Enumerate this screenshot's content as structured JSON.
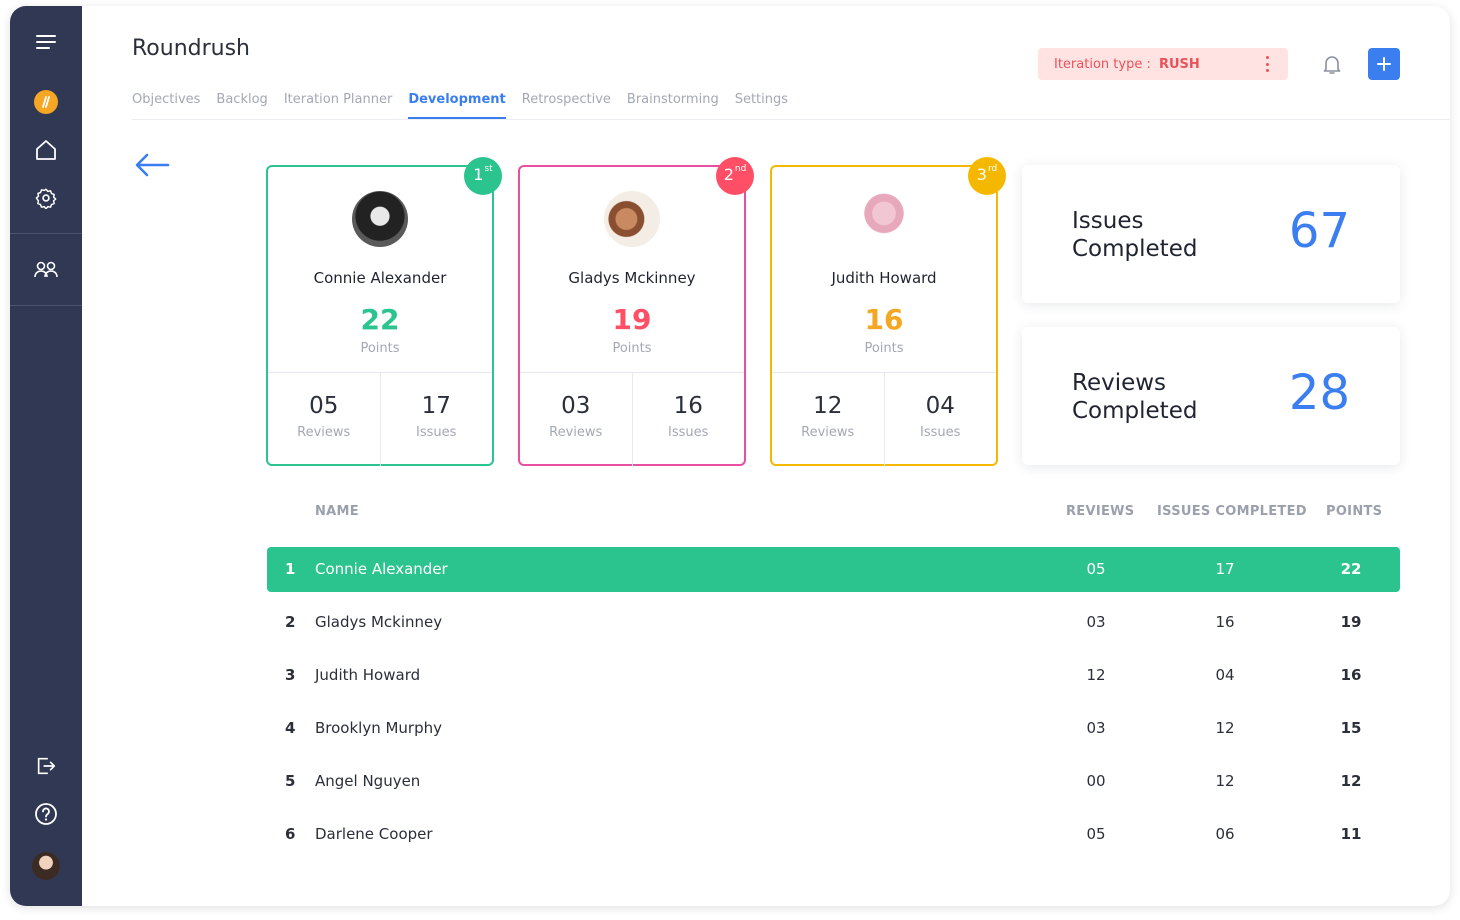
{
  "app": {
    "title": "Roundrush"
  },
  "tabs": [
    {
      "label": "Objectives",
      "active": false
    },
    {
      "label": "Backlog",
      "active": false
    },
    {
      "label": "Iteration Planner",
      "active": false
    },
    {
      "label": "Development",
      "active": true
    },
    {
      "label": "Retrospective",
      "active": false
    },
    {
      "label": "Brainstorming",
      "active": false
    },
    {
      "label": "Settings",
      "active": false
    }
  ],
  "iteration": {
    "label": "Iteration type : ",
    "value": "RUSH"
  },
  "colors": {
    "sidebar": "#303853",
    "accent": "#3b7ef0",
    "first": "#2bc48e",
    "second": "#ff4f66",
    "third": "#f5b800",
    "highlight_row": "#2bc48e"
  },
  "podium": [
    {
      "rank": "1",
      "suffix": "st",
      "name": "Connie Alexander",
      "points": "22",
      "points_label": "Points",
      "reviews": "05",
      "reviews_label": "Reviews",
      "issues": "17",
      "issues_label": "Issues",
      "border_color": "#2bc48e",
      "badge_color": "#2bc48e",
      "points_color": "#2bc48e"
    },
    {
      "rank": "2",
      "suffix": "nd",
      "name": "Gladys Mckinney",
      "points": "19",
      "points_label": "Points",
      "reviews": "03",
      "reviews_label": "Reviews",
      "issues": "16",
      "issues_label": "Issues",
      "border_color": "#e94fa0",
      "badge_color": "#ff4f66",
      "points_color": "#ff4f66"
    },
    {
      "rank": "3",
      "suffix": "rd",
      "name": "Judith Howard",
      "points": "16",
      "points_label": "Points",
      "reviews": "12",
      "reviews_label": "Reviews",
      "issues": "04",
      "issues_label": "Issues",
      "border_color": "#f5b800",
      "badge_color": "#f5b800",
      "points_color": "#f5a623"
    }
  ],
  "summary": [
    {
      "label": "Issues Completed",
      "value": "67"
    },
    {
      "label": "Reviews Completed",
      "value": "28"
    }
  ],
  "table": {
    "headers": {
      "name": "NAME",
      "reviews": "REVIEWS",
      "issues": "ISSUES COMPLETED",
      "points": "POINTS"
    },
    "rows": [
      {
        "rank": "1",
        "name": "Connie Alexander",
        "reviews": "05",
        "issues": "17",
        "points": "22",
        "highlighted": true
      },
      {
        "rank": "2",
        "name": "Gladys Mckinney",
        "reviews": "03",
        "issues": "16",
        "points": "19",
        "highlighted": false
      },
      {
        "rank": "3",
        "name": "Judith Howard",
        "reviews": "12",
        "issues": "04",
        "points": "16",
        "highlighted": false
      },
      {
        "rank": "4",
        "name": "Brooklyn Murphy",
        "reviews": "03",
        "issues": "12",
        "points": "15",
        "highlighted": false
      },
      {
        "rank": "5",
        "name": "Angel Nguyen",
        "reviews": "00",
        "issues": "12",
        "points": "12",
        "highlighted": false
      },
      {
        "rank": "6",
        "name": "Darlene Cooper",
        "reviews": "05",
        "issues": "06",
        "points": "11",
        "highlighted": false
      }
    ]
  },
  "icons": {
    "sidebar_top": [
      "menu-icon",
      "logo-icon",
      "home-icon",
      "settings-icon",
      "team-icon"
    ],
    "sidebar_bottom": [
      "logout-icon",
      "help-icon",
      "user-avatar"
    ],
    "header": [
      "bell-icon",
      "plus-icon",
      "kebab-icon"
    ],
    "back": "back-arrow-icon"
  }
}
